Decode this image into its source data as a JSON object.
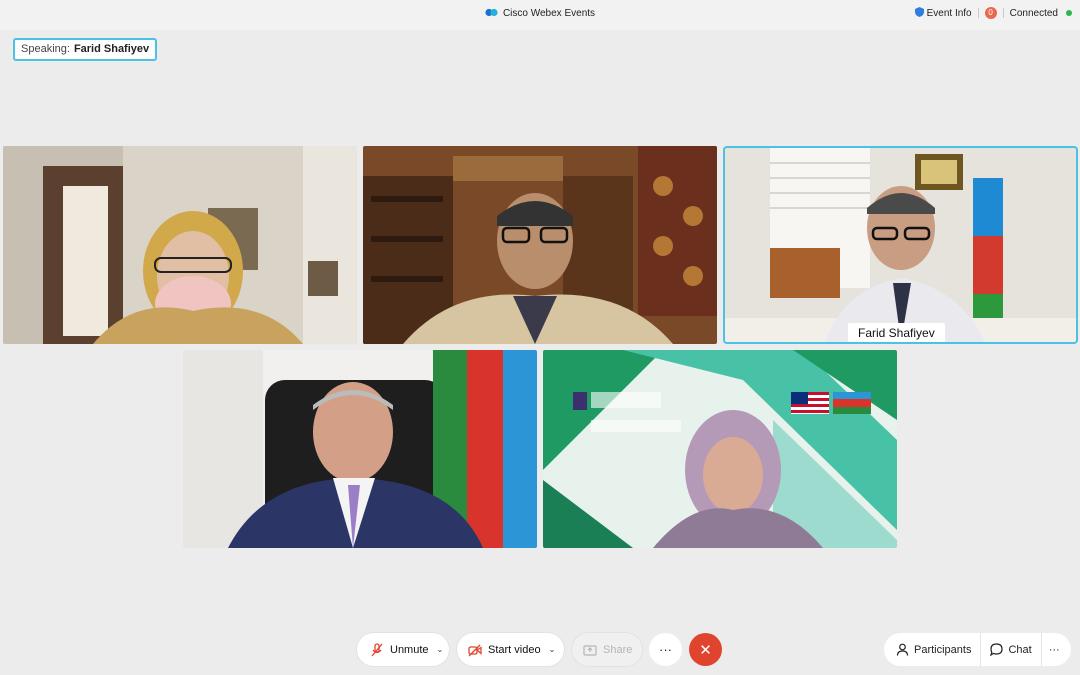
{
  "titlebar": {
    "app_title": "Cisco Webex Events",
    "event_info": "Event Info",
    "record_badge": "0",
    "connection_status": "Connected"
  },
  "speaking": {
    "label": "Speaking:",
    "name": "Farid Shafiyev"
  },
  "tiles": {
    "active_speaker_name": "Farid Shafiyev"
  },
  "toolbar": {
    "unmute_label": "Unmute",
    "start_video_label": "Start video",
    "share_label": "Share",
    "more_label": "···",
    "participants_label": "Participants",
    "chat_label": "Chat",
    "overflow_label": "···"
  },
  "colors": {
    "accent": "#4cc1e6",
    "end_call": "#e0442f",
    "connected": "#2bb84a"
  }
}
